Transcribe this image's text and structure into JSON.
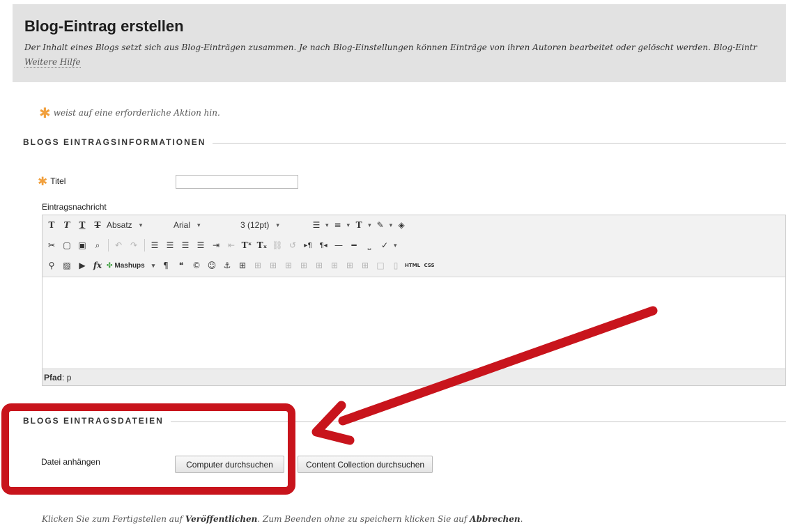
{
  "header": {
    "title": "Blog-Eintrag erstellen",
    "intro": "Der Inhalt eines Blogs setzt sich aus Blog-Einträgen zusammen. Je nach Blog-Einstellungen können Einträge von ihren Autoren bearbeitet oder gelöscht werden. Blog-Eintr",
    "help_link": "Weitere Hilfe"
  },
  "required_note": "weist auf eine erforderliche Aktion hin.",
  "section_info": {
    "heading": "BLOGS EINTRAGSINFORMATIONEN",
    "title_label": "Titel",
    "title_value": "",
    "message_label": "Eintragsnachricht"
  },
  "editor": {
    "paragraph_format": "Absatz",
    "font_family": "Arial",
    "font_size": "3 (12pt)",
    "mashups": "Mashups",
    "html_label": "HTML",
    "css_label": "CSS",
    "path_label": "Pfad",
    "path_value": "p"
  },
  "section_files": {
    "heading": "BLOGS EINTRAGSDATEIEN",
    "attach_label": "Datei anhängen",
    "browse_computer": "Computer durchsuchen",
    "browse_collection": "Content Collection durchsuchen"
  },
  "footer": {
    "part1": "Klicken Sie zum Fertigstellen auf ",
    "publish": "Veröffentlichen",
    "part2": ". Zum Beenden ohne zu speichern klicken Sie auf ",
    "cancel": "Abbrechen",
    "part3": "."
  },
  "colors": {
    "required_star": "#f1a03e",
    "annotation_red": "#c8141c",
    "header_bg": "#e2e2e2"
  }
}
